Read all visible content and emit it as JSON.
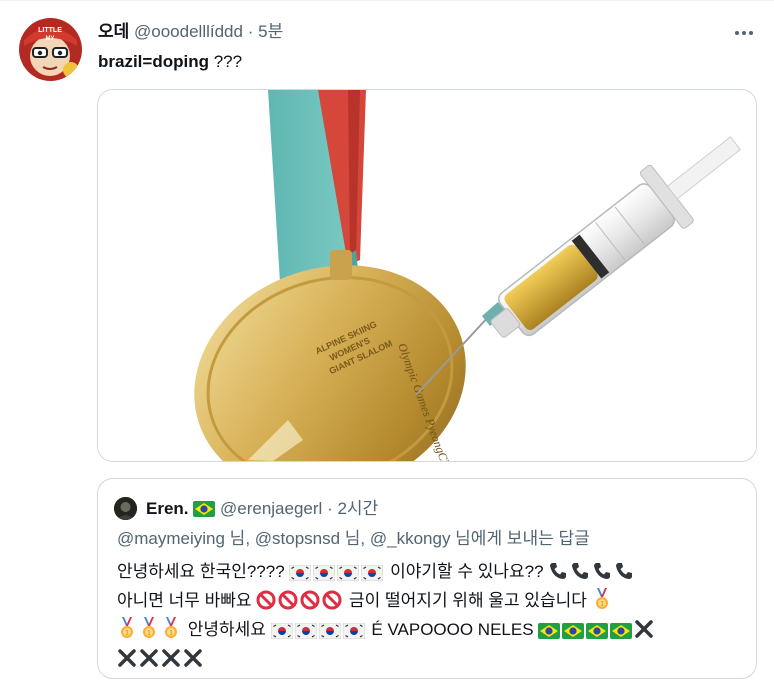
{
  "tweet": {
    "display_name": "오데",
    "handle": "@ooodelllíddd",
    "separator": "·",
    "time": "5분",
    "text_bold": "brazil=doping",
    "text_rest": " ???",
    "avatar_text_top": "LITTLE",
    "avatar_text_bottom": "MY",
    "more_icon": "more-icon"
  },
  "media": {
    "medal_text_1": "ALPINE SKIING",
    "medal_text_2": "WOMEN'S",
    "medal_text_3": "GIANT SLALOM",
    "medal_rim_text": "Olympic Games PyeongChang"
  },
  "quote": {
    "display_name": "Eren.",
    "handle": "@erenjaegerl",
    "separator": "·",
    "time": "2시간",
    "reply_line": "@maymeiying 님, @stopsnsd 님, @_kkongy 님에게 보내는 답글",
    "line1_text": "안녕하세요 한국인???? ",
    "line1_mid": " 이야기할 수 있나요?? ",
    "line2_text": "아니면 너무 바빠요 ",
    "line2_mid": " 금이 떨어지기 위해 울고 있습니다 ",
    "line3_mid": " 안녕하세요 ",
    "line3_tail": " É VAPOOOO NELES "
  },
  "colors": {
    "text_primary": "#0f1419",
    "text_secondary": "#536471",
    "border": "#cfd9de"
  }
}
